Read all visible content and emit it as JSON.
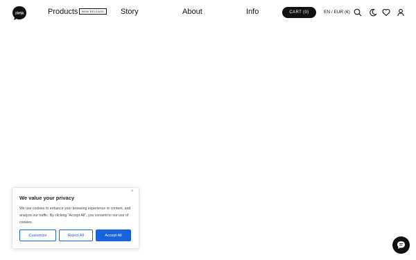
{
  "header": {
    "logo_text": "zieta",
    "nav": {
      "products": "Products",
      "badge": "NEW RELEASE",
      "story": "Story",
      "about": "About",
      "info": "Info"
    },
    "cart_label": "CART (0)",
    "locale": "EN / EUR (€)",
    "icons": [
      "search-icon",
      "moon-icon",
      "heart-icon",
      "user-icon"
    ]
  },
  "cookie_banner": {
    "title": "We value your privacy",
    "text": "We use cookies to enhance your browsing experience or content, and analyze our traffic. By clicking \"Accept All\", you consent to our use of cookies.",
    "close": "×",
    "buttons": {
      "customize": "Customize",
      "reject": "Reject All",
      "accept": "Accept All"
    }
  },
  "chat": {
    "icon": "chat-icon"
  },
  "colors": {
    "accent": "#1863dc",
    "dark": "#111111",
    "background": "#ffffff"
  }
}
